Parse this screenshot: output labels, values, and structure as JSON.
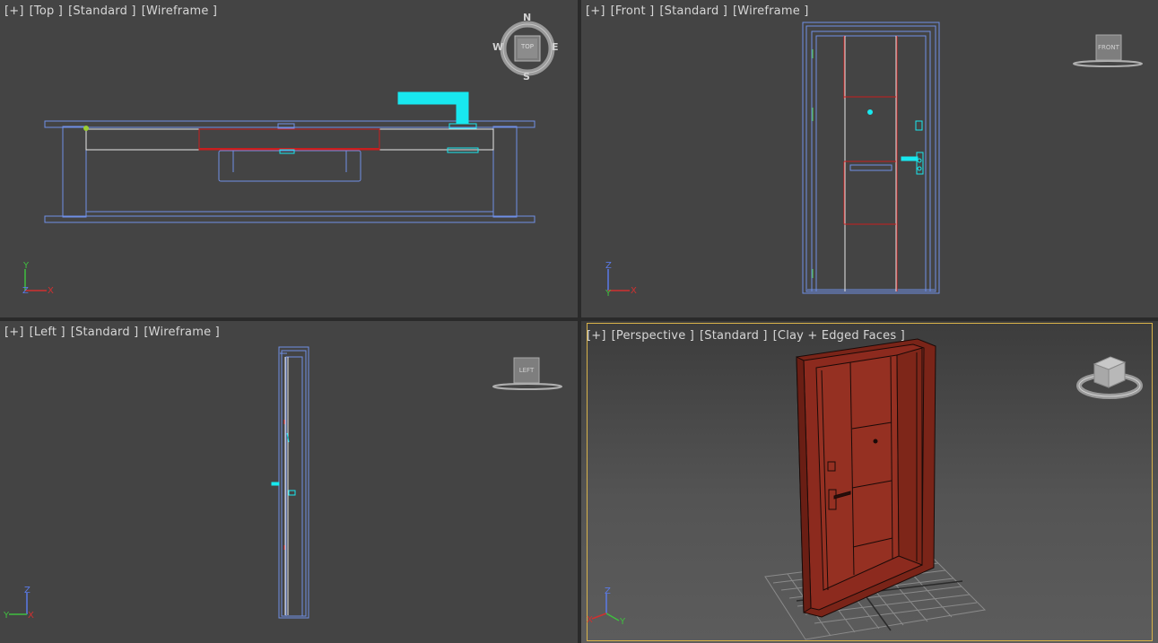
{
  "viewports": {
    "top": {
      "menu": "[+]",
      "view": "[Top ]",
      "shading_mode": "[Standard ]",
      "display": "[Wireframe ]",
      "compass": {
        "n": "N",
        "s": "S",
        "e": "E",
        "w": "W",
        "cube_face": "TOP"
      }
    },
    "front": {
      "menu": "[+]",
      "view": "[Front ]",
      "shading_mode": "[Standard ]",
      "display": "[Wireframe ]",
      "cube_face": "FRONT"
    },
    "left": {
      "menu": "[+]",
      "view": "[Left ]",
      "shading_mode": "[Standard ]",
      "display": "[Wireframe ]",
      "cube_face": "LEFT"
    },
    "perspective": {
      "menu": "[+]",
      "view": "[Perspective ]",
      "shading_mode": "[Standard ]",
      "display": "[Clay + Edged Faces ]"
    }
  },
  "colors": {
    "viewport_bg": "#444444",
    "wire_blue": "#6f8fe6",
    "wire_red": "#c81e1e",
    "wire_white": "#e8e8e8",
    "handle_cyan": "#18e8ef",
    "door_clay": "#8c2a1e",
    "active_border": "#d8b24a"
  },
  "axes": {
    "x": "X",
    "y": "Y",
    "z": "Z"
  }
}
